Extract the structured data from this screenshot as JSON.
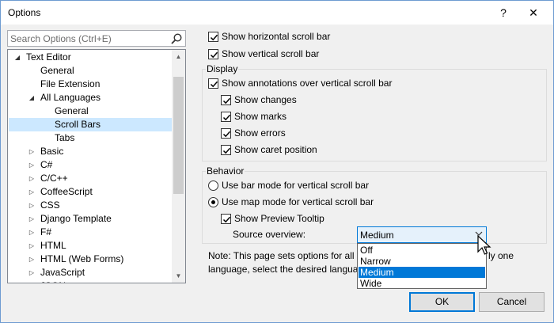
{
  "window": {
    "title": "Options",
    "help_label": "?",
    "close_label": "✕"
  },
  "search": {
    "placeholder": "Search Options (Ctrl+E)",
    "value": ""
  },
  "tree": {
    "items": [
      {
        "label": "Text Editor",
        "arrow": "◢"
      },
      {
        "label": "General"
      },
      {
        "label": "File Extension"
      },
      {
        "label": "All Languages",
        "arrow": "◢"
      },
      {
        "label": "General"
      },
      {
        "label": "Scroll Bars",
        "selected": true
      },
      {
        "label": "Tabs"
      },
      {
        "label": "Basic",
        "arrow": "▷"
      },
      {
        "label": "C#",
        "arrow": "▷"
      },
      {
        "label": "C/C++",
        "arrow": "▷"
      },
      {
        "label": "CoffeeScript",
        "arrow": "▷"
      },
      {
        "label": "CSS",
        "arrow": "▷"
      },
      {
        "label": "Django Template",
        "arrow": "▷"
      },
      {
        "label": "F#",
        "arrow": "▷"
      },
      {
        "label": "HTML",
        "arrow": "▷"
      },
      {
        "label": "HTML (Web Forms)",
        "arrow": "▷"
      },
      {
        "label": "JavaScript",
        "arrow": "▷"
      },
      {
        "label": "JSON",
        "arrow": "▷"
      }
    ],
    "scroll_up": "▲",
    "scroll_down": "▼"
  },
  "panel": {
    "show_horizontal": {
      "label": "Show horizontal scroll bar",
      "checked": true
    },
    "show_vertical": {
      "label": "Show vertical scroll bar",
      "checked": true
    },
    "display_group": "Display",
    "show_annotations": {
      "label": "Show annotations over vertical scroll bar",
      "checked": true
    },
    "show_changes": {
      "label": "Show changes",
      "checked": true
    },
    "show_marks": {
      "label": "Show marks",
      "checked": true
    },
    "show_errors": {
      "label": "Show errors",
      "checked": true
    },
    "show_caret": {
      "label": "Show caret position",
      "checked": true
    },
    "behavior_group": "Behavior",
    "bar_mode": {
      "label": "Use bar mode for vertical scroll bar",
      "selected": false
    },
    "map_mode": {
      "label": "Use map mode for vertical scroll bar",
      "selected": true
    },
    "preview_tooltip": {
      "label": "Show Preview Tooltip",
      "checked": true
    },
    "source_overview_label": "Source overview:",
    "source_overview_value": "Medium",
    "source_overview_options": [
      "Off",
      "Narrow",
      "Medium",
      "Wide"
    ],
    "note_line1": "Note: This page sets options for all lan",
    "note_line1_tail": "ly one",
    "note_line2": "language, select the desired language"
  },
  "buttons": {
    "ok": "OK",
    "cancel": "Cancel"
  },
  "colors": {
    "accent": "#0078d7",
    "selection": "#cce8ff"
  }
}
